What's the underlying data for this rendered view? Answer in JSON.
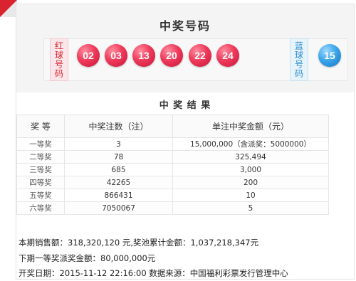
{
  "header": {
    "title": "中奖号码"
  },
  "labels": {
    "red": "红球号码",
    "blue": "蓝球号码"
  },
  "red_balls": [
    "02",
    "03",
    "13",
    "20",
    "22",
    "24"
  ],
  "blue_ball": "15",
  "colors": {
    "brand_red": "#d9232e",
    "red_ball": "#e8314f",
    "blue_ball": "#2a8dd4"
  },
  "results": {
    "title": "中 奖 结 果",
    "columns": [
      "奖 等",
      "中奖注数（注）",
      "单注中奖金额（元）"
    ],
    "rows": [
      {
        "prize": "一等奖",
        "count": "3",
        "amount": "15,000,000（含派奖：5000000）"
      },
      {
        "prize": "二等奖",
        "count": "78",
        "amount": "325,494"
      },
      {
        "prize": "三等奖",
        "count": "685",
        "amount": "3,000"
      },
      {
        "prize": "四等奖",
        "count": "42265",
        "amount": "200"
      },
      {
        "prize": "五等奖",
        "count": "866431",
        "amount": "10"
      },
      {
        "prize": "六等奖",
        "count": "7050067",
        "amount": "5"
      }
    ]
  },
  "summary": {
    "sales": "本期销售额：318,320,120 元,奖池累计金额：1,037,218,347元",
    "next_jackpot": "下期一等奖派奖金额：80,000,000元",
    "draw_info": "开奖日期：2015-11-12 22:16:00 数据来源：中国福利彩票发行管理中心"
  }
}
